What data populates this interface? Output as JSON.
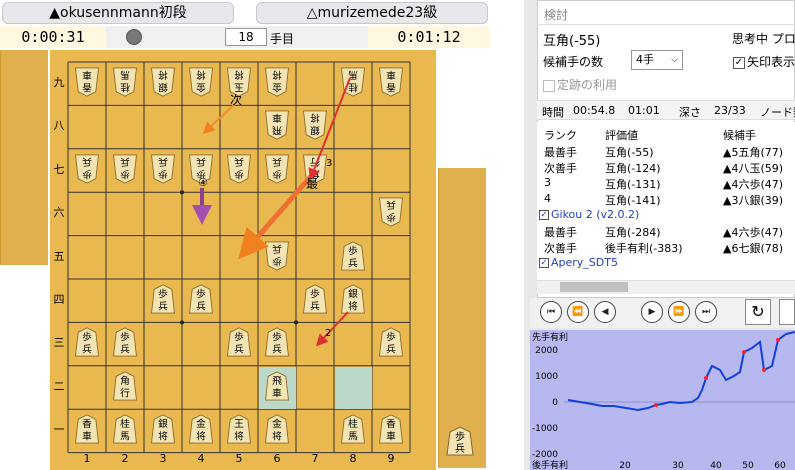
{
  "players": {
    "black_name": "▲okusennmann初段",
    "white_name": "△murizemede23級",
    "black_time": "0:00:31",
    "white_time": "0:01:12",
    "move_number": "18",
    "move_unit": "手目"
  },
  "board": {
    "file_labels": [
      "1",
      "2",
      "3",
      "4",
      "5",
      "6",
      "7",
      "8",
      "9"
    ],
    "rank_labels": [
      "九",
      "八",
      "七",
      "六",
      "五",
      "四",
      "三",
      "二",
      "一"
    ],
    "pieces": [
      {
        "c": 0,
        "r": 0,
        "t": "香",
        "t2": "車",
        "g": true
      },
      {
        "c": 1,
        "r": 0,
        "t": "桂",
        "t2": "馬",
        "g": true
      },
      {
        "c": 2,
        "r": 0,
        "t": "銀",
        "t2": "将",
        "g": true
      },
      {
        "c": 3,
        "r": 0,
        "t": "金",
        "t2": "将",
        "g": true
      },
      {
        "c": 4,
        "r": 0,
        "t": "玉",
        "t2": "将",
        "g": true
      },
      {
        "c": 5,
        "r": 0,
        "t": "金",
        "t2": "将",
        "g": true
      },
      {
        "c": 7,
        "r": 0,
        "t": "桂",
        "t2": "馬",
        "g": true
      },
      {
        "c": 8,
        "r": 0,
        "t": "香",
        "t2": "車",
        "g": true
      },
      {
        "c": 5,
        "r": 1,
        "t": "飛",
        "t2": "車",
        "g": true
      },
      {
        "c": 6,
        "r": 1,
        "t": "銀",
        "t2": "将",
        "g": true
      },
      {
        "c": 0,
        "r": 2,
        "t": "歩",
        "t2": "兵",
        "g": true
      },
      {
        "c": 1,
        "r": 2,
        "t": "歩",
        "t2": "兵",
        "g": true
      },
      {
        "c": 2,
        "r": 2,
        "t": "歩",
        "t2": "兵",
        "g": true
      },
      {
        "c": 3,
        "r": 2,
        "t": "歩",
        "t2": "兵",
        "g": true
      },
      {
        "c": 4,
        "r": 2,
        "t": "歩",
        "t2": "兵",
        "g": true
      },
      {
        "c": 5,
        "r": 2,
        "t": "歩",
        "t2": "兵",
        "g": true
      },
      {
        "c": 6,
        "r": 2,
        "t": "角",
        "t2": "行",
        "g": true
      },
      {
        "c": 8,
        "r": 3,
        "t": "歩",
        "t2": "兵",
        "g": true
      },
      {
        "c": 5,
        "r": 4,
        "t": "歩",
        "t2": "兵",
        "g": true
      },
      {
        "c": 7,
        "r": 4,
        "t": "歩",
        "t2": "兵",
        "g": false
      },
      {
        "c": 2,
        "r": 5,
        "t": "歩",
        "t2": "兵",
        "g": false
      },
      {
        "c": 3,
        "r": 5,
        "t": "歩",
        "t2": "兵",
        "g": false
      },
      {
        "c": 6,
        "r": 5,
        "t": "歩",
        "t2": "兵",
        "g": false
      },
      {
        "c": 7,
        "r": 5,
        "t": "銀",
        "t2": "将",
        "g": false
      },
      {
        "c": 0,
        "r": 6,
        "t": "歩",
        "t2": "兵",
        "g": false
      },
      {
        "c": 1,
        "r": 6,
        "t": "歩",
        "t2": "兵",
        "g": false
      },
      {
        "c": 4,
        "r": 6,
        "t": "歩",
        "t2": "兵",
        "g": false
      },
      {
        "c": 5,
        "r": 6,
        "t": "歩",
        "t2": "兵",
        "g": false
      },
      {
        "c": 8,
        "r": 6,
        "t": "歩",
        "t2": "兵",
        "g": false
      },
      {
        "c": 1,
        "r": 7,
        "t": "角",
        "t2": "行",
        "g": false
      },
      {
        "c": 5,
        "r": 7,
        "t": "飛",
        "t2": "車",
        "g": false
      },
      {
        "c": 0,
        "r": 8,
        "t": "香",
        "t2": "車",
        "g": false
      },
      {
        "c": 1,
        "r": 8,
        "t": "桂",
        "t2": "馬",
        "g": false
      },
      {
        "c": 2,
        "r": 8,
        "t": "銀",
        "t2": "将",
        "g": false
      },
      {
        "c": 3,
        "r": 8,
        "t": "金",
        "t2": "将",
        "g": false
      },
      {
        "c": 4,
        "r": 8,
        "t": "王",
        "t2": "将",
        "g": false
      },
      {
        "c": 5,
        "r": 8,
        "t": "金",
        "t2": "将",
        "g": false
      },
      {
        "c": 7,
        "r": 8,
        "t": "桂",
        "t2": "馬",
        "g": false
      },
      {
        "c": 8,
        "r": 8,
        "t": "香",
        "t2": "車",
        "g": false
      }
    ],
    "highlights": [
      {
        "c": 5,
        "r": 7
      },
      {
        "c": 7,
        "r": 7
      }
    ],
    "arrow_labels": {
      "next": "次",
      "best": "最",
      "n3": "3",
      "n4": "④",
      "n2": "2"
    },
    "hand_piece": {
      "t": "歩",
      "t2": "兵"
    }
  },
  "analysis": {
    "window_title": "検討",
    "eval_title": "互角(-55)",
    "thinking_label": "思考中 プロ",
    "candidates_label": "候補手の数",
    "candidates_value": "4手",
    "arrows_label": "矢印表示",
    "joseki_label": "定跡の利用",
    "time_label": "時間",
    "time_value": "00:54.8",
    "time_value2": "01:01",
    "depth_label": "深さ",
    "depth_value": "23/33",
    "nodes_label": "ノード数",
    "col_rank": "ランク",
    "col_eval": "評価値",
    "col_move": "候補手",
    "engine1_rows": [
      {
        "rank": "最善手",
        "eval": "互角(-55)",
        "move": "▲5五角(77)"
      },
      {
        "rank": "次善手",
        "eval": "互角(-124)",
        "move": "▲4八玉(59)"
      },
      {
        "rank": "3",
        "eval": "互角(-131)",
        "move": "▲4六歩(47)"
      },
      {
        "rank": "4",
        "eval": "互角(-141)",
        "move": "▲3八銀(39)"
      }
    ],
    "engine2_name": "Gikou 2 (v2.0.2)",
    "engine2_rows": [
      {
        "rank": "最善手",
        "eval": "互角(-284)",
        "move": "▲4六歩(47)"
      },
      {
        "rank": "次善手",
        "eval": "後手有利(-383)",
        "move": "▲6七銀(78)"
      }
    ],
    "engine3_name": "Apery_SDT5"
  },
  "graph": {
    "top_label": "先手有利",
    "bottom_label": "後手有利",
    "y_ticks": [
      "2000",
      "1000",
      "0",
      "-1000",
      "-2000"
    ],
    "x_ticks": [
      "20",
      "30",
      "40",
      "50",
      "60"
    ],
    "line_color": "#1040e0",
    "point_color": "#ff2020"
  }
}
